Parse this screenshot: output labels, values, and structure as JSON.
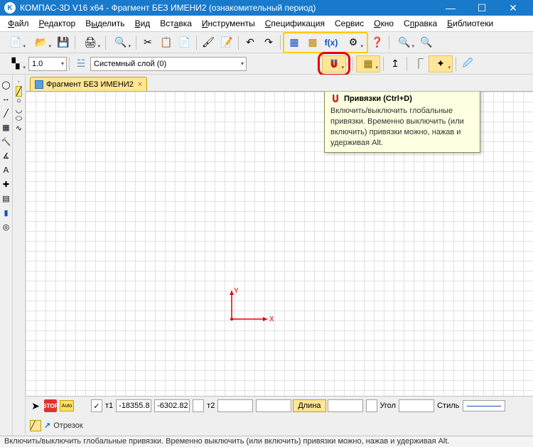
{
  "window": {
    "title": "КОМПАС-3D V16  x64 - Фрагмент БЕЗ ИМЕНИ2 (ознакомительный период)"
  },
  "menu": {
    "items": [
      {
        "label": "Файл",
        "key": "Ф"
      },
      {
        "label": "Редактор",
        "key": "Р"
      },
      {
        "label": "Выделить",
        "key": "ы"
      },
      {
        "label": "Вид",
        "key": "В"
      },
      {
        "label": "Вставка",
        "key": "а"
      },
      {
        "label": "Инструменты",
        "key": "И"
      },
      {
        "label": "Спецификация",
        "key": "С"
      },
      {
        "label": "Сервис",
        "key": "р"
      },
      {
        "label": "Окно",
        "key": "О"
      },
      {
        "label": "Справка",
        "key": "п"
      },
      {
        "label": "Библиотеки",
        "key": "Б"
      }
    ]
  },
  "layerbar": {
    "scale": "1.0",
    "layer": "Системный слой (0)"
  },
  "tab": {
    "label": "Фрагмент БЕЗ ИМЕНИ2"
  },
  "tooltip": {
    "title": "Привязки (Ctrl+D)",
    "body": "Включить/выключить глобальные привязки. Временно выключить (или включить) привязки можно, нажав и удерживая Alt."
  },
  "axes": {
    "x": "X",
    "y": "Y"
  },
  "bottom": {
    "auto": "Auto",
    "stop": "STOP",
    "t1label": "т1",
    "t1x": "-18355.8",
    "t1y": "-6302.82",
    "t2label": "т2",
    "t2x": "",
    "t2y": "",
    "len_label": "Длина",
    "len": "",
    "ang_label": "Угол",
    "ang": "",
    "style_label": "Стиль",
    "mode": "Отрезок"
  },
  "status": {
    "text": "Включить/выключить глобальные привязки. Временно выключить (или включить) привязки можно, нажав и удерживая Alt."
  }
}
